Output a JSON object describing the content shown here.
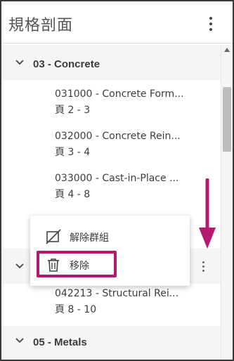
{
  "panel": {
    "title": "規格剖面"
  },
  "groups": [
    {
      "label": "03 - Concrete",
      "expanded": true,
      "sections": [
        {
          "name": "031000 - Concrete Form...",
          "pages": "頁 2 - 3"
        },
        {
          "name": "032000 - Concrete Rein...",
          "pages": "頁 3 - 4"
        },
        {
          "name": "033000 - Cast-in-Place ...",
          "pages": "頁 4 - 8"
        }
      ]
    },
    {
      "label": "",
      "expanded": true,
      "sections": [
        {
          "name": "042213 - Structural Rei...",
          "pages": "頁 8 - 10"
        }
      ]
    },
    {
      "label": "05 - Metals",
      "expanded": true,
      "sections": []
    }
  ],
  "context_menu": {
    "items": [
      {
        "label": "解除群組",
        "icon": "ungroup-icon"
      },
      {
        "label": "移除",
        "icon": "trash-icon"
      }
    ]
  },
  "annotation": {
    "color": "#b4186f"
  }
}
